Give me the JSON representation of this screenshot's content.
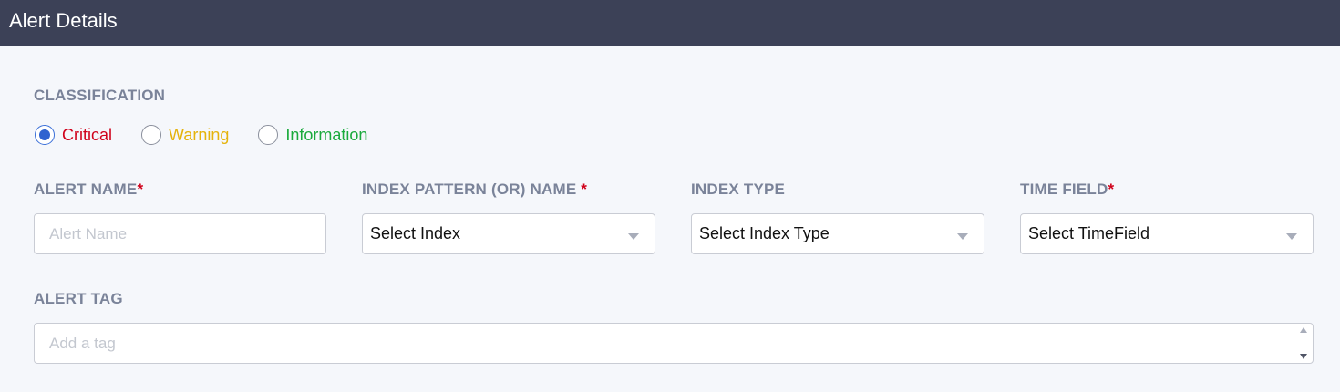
{
  "header": {
    "title": "Alert Details"
  },
  "classification": {
    "label": "CLASSIFICATION",
    "options": [
      {
        "label": "Critical",
        "color": "#d0021b",
        "checked": true
      },
      {
        "label": "Warning",
        "color": "#e5b30b",
        "checked": false
      },
      {
        "label": "Information",
        "color": "#1aaa3c",
        "checked": false
      }
    ]
  },
  "fields": {
    "alert_name": {
      "label": "ALERT NAME",
      "required_mark": "*",
      "placeholder": "Alert Name"
    },
    "index_pattern": {
      "label": "INDEX PATTERN (OR) NAME ",
      "required_mark": "*",
      "value": "Select Index"
    },
    "index_type": {
      "label": "INDEX TYPE",
      "value": "Select Index Type"
    },
    "time_field": {
      "label": "TIME FIELD",
      "required_mark": "*",
      "value": "Select TimeField"
    },
    "alert_tag": {
      "label": "ALERT TAG",
      "placeholder": "Add a tag"
    }
  },
  "icons": {
    "dropdown": "chevron-down-icon",
    "spinner_up": "caret-up-icon",
    "spinner_down": "caret-down-icon"
  }
}
